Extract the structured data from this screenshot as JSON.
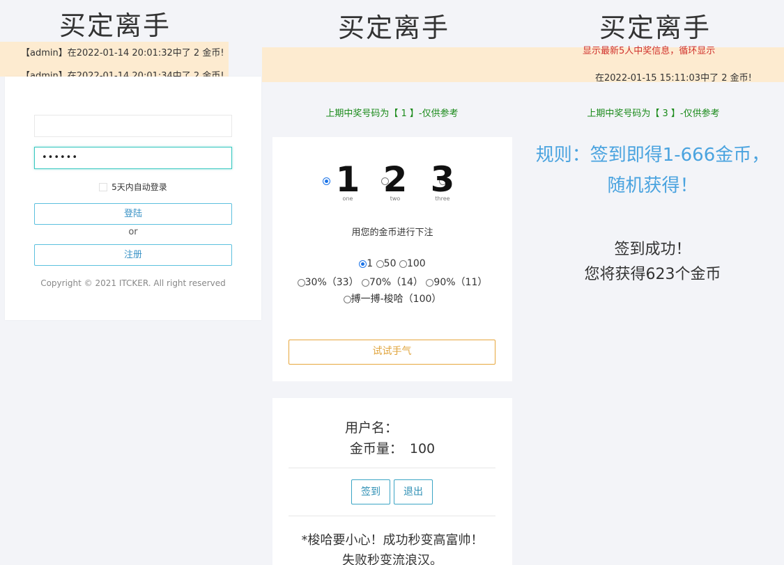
{
  "panel_left": {
    "title": "买定离手",
    "ticker_lines": [
      "【admin】在2022-01-14 20:01:32中了 2 金币!",
      "【admin】在2022-01-14 20:01:34中了 2 金币!"
    ],
    "password_mask": "••••••",
    "remember_label": "5天内自动登录",
    "login_label": "登陆",
    "or_label": "or",
    "register_label": "注册",
    "copyright": "Copyright © 2021 ITCKER. All right reserved"
  },
  "panel_mid": {
    "title": "买定离手",
    "last_number_text": "上期中奖号码为【 1 】-仅供参考",
    "numbers": [
      {
        "digit": "1",
        "sub": "one",
        "selected": true
      },
      {
        "digit": "2",
        "sub": "two",
        "selected": false
      },
      {
        "digit": "3",
        "sub": "three",
        "selected": false
      }
    ],
    "bet_prompt": "用您的金币进行下注",
    "amount_options": [
      "1",
      "50",
      "100"
    ],
    "odds_options": [
      "30%（33）",
      "70%（14）",
      "90%（11）"
    ],
    "allin_option": "搏一搏-梭哈（100）",
    "try_button": "试试手气",
    "username_label": "用户名：",
    "username_value": "",
    "coins_label": "金币量：",
    "coins_value": "100",
    "checkin_button": "签到",
    "logout_button": "退出",
    "warning_line1": "*梭哈要小心！成功秒变高富帅！",
    "warning_line2": "失败秒变流浪汉。"
  },
  "panel_right": {
    "title": "买定离手",
    "ticker_top": "显示最新5人中奖信息，循环显示",
    "ticker_line": "在2022-01-15 15:11:03中了 2 金币!",
    "last_number_text": "上期中奖号码为【 3 】-仅供参考",
    "rule_line1": "规则：签到即得1-666金币，",
    "rule_line2": "随机获得！",
    "success_line1": "签到成功！",
    "success_line2": "您将获得623个金币"
  },
  "colors": {
    "ticker_bg": "#fdebd0",
    "accent_teal": "#38c8c0",
    "accent_blue": "#5bc0de",
    "accent_orange": "#e7a63c",
    "rule_blue": "#4aa3df",
    "green": "#1a8a1a"
  }
}
